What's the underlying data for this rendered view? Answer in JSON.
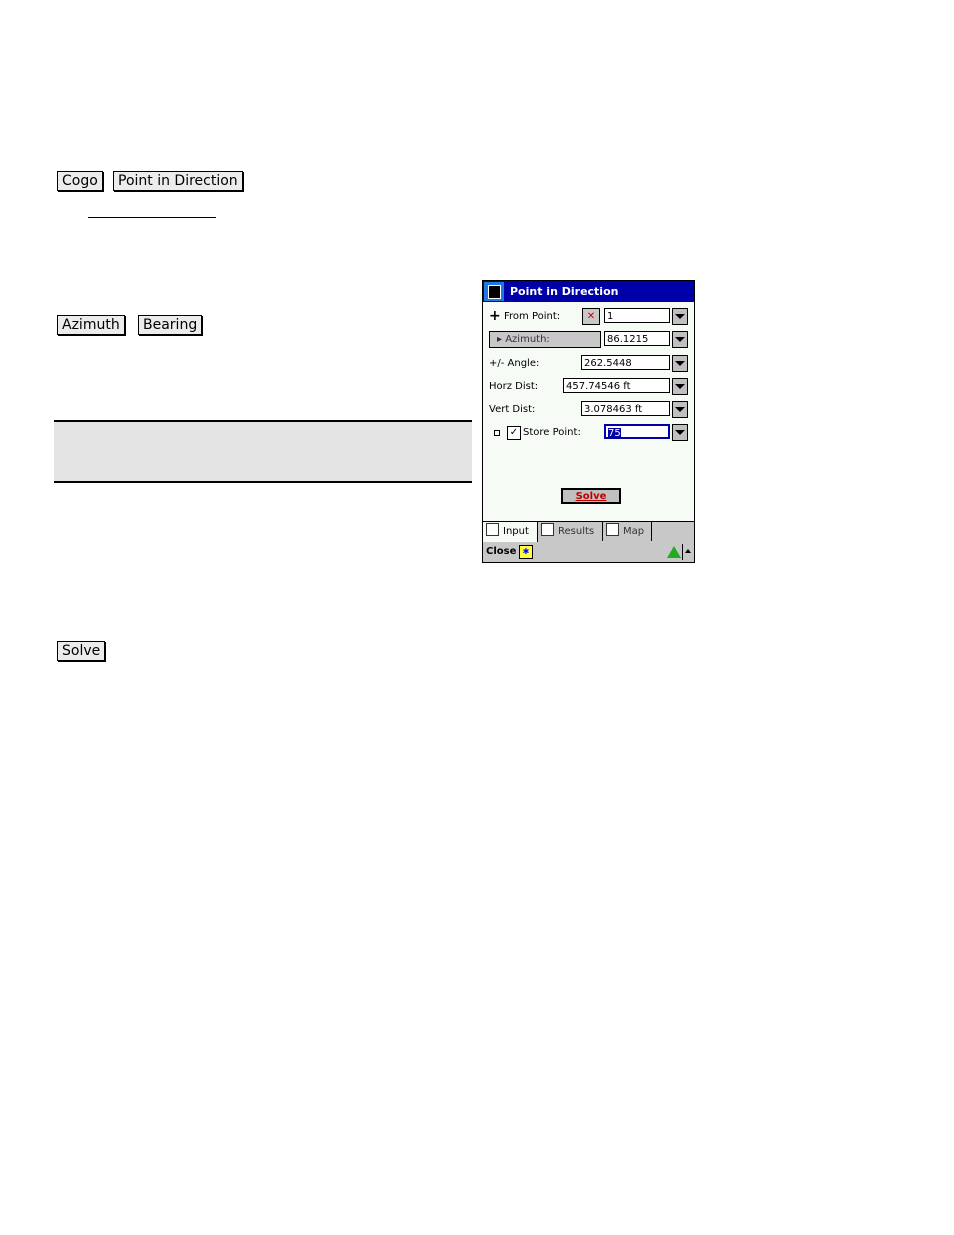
{
  "doc": {
    "menu_path": [
      "Cogo",
      "Point in Direction"
    ],
    "mode_buttons": [
      "Azimuth",
      "Bearing"
    ],
    "solve_button": "Solve"
  },
  "device": {
    "title": "Point in Direction",
    "from_point_label": "From Point:",
    "from_point_value": "1",
    "azimuth_label": "Azimuth:",
    "azimuth_value": "86.1215",
    "angle_label": "+/- Angle:",
    "angle_value": "262.5448",
    "horz_dist_label": "Horz Dist:",
    "horz_dist_value": "457.74546 ft",
    "vert_dist_label": "Vert Dist:",
    "vert_dist_value": "3.078463 ft",
    "store_point_label": "Store Point:",
    "store_point_checked": true,
    "store_point_value": "75",
    "solve_label": "Solve",
    "tabs": [
      {
        "label": "Input",
        "active": true
      },
      {
        "label": "Results",
        "active": false
      },
      {
        "label": "Map",
        "active": false
      }
    ],
    "close_label": "Close",
    "accent_color": "#0000a8",
    "solve_color": "#c00000"
  }
}
